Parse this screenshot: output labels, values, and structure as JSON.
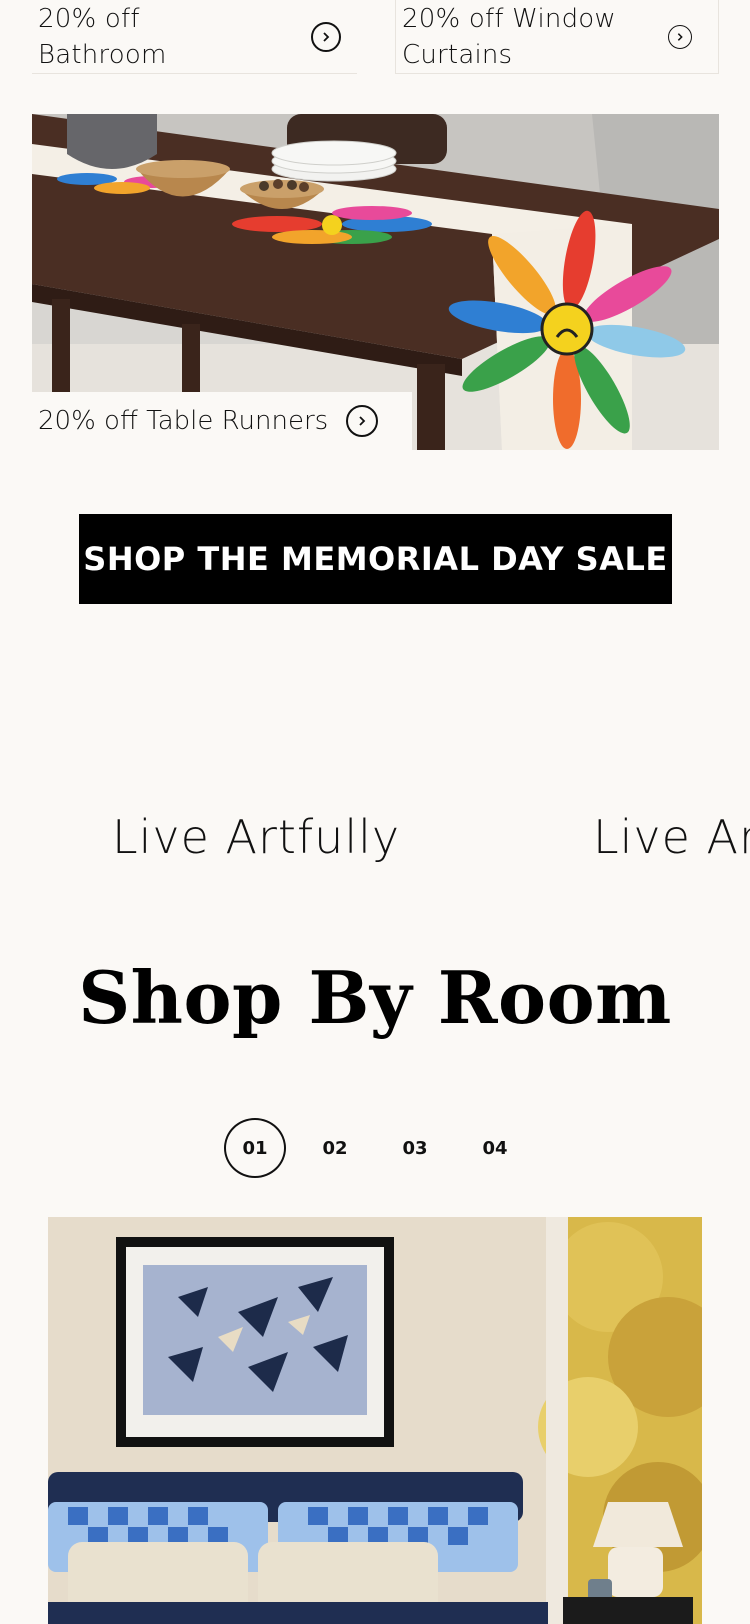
{
  "promos": {
    "bathroom": {
      "label_line1": "20% off",
      "label_line2": "Bathroom"
    },
    "window_curtains": {
      "label_line1": "20% off Window",
      "label_line2": "Curtains"
    },
    "table_runners": {
      "label": "20% off Table Runners"
    }
  },
  "cta": {
    "label": "SHOP THE MEMORIAL DAY SALE"
  },
  "marquee": {
    "items": [
      "Live Artfully",
      "Live Ar"
    ]
  },
  "shop_by_room": {
    "title": "Shop By Room",
    "pages": [
      "01",
      "02",
      "03",
      "04"
    ],
    "active_page": "01"
  },
  "icons": {
    "arrow": "chevron-right-circle-icon"
  },
  "colors": {
    "background": "#fbf9f6",
    "cta_background": "#000000",
    "cta_text": "#ffffff"
  }
}
